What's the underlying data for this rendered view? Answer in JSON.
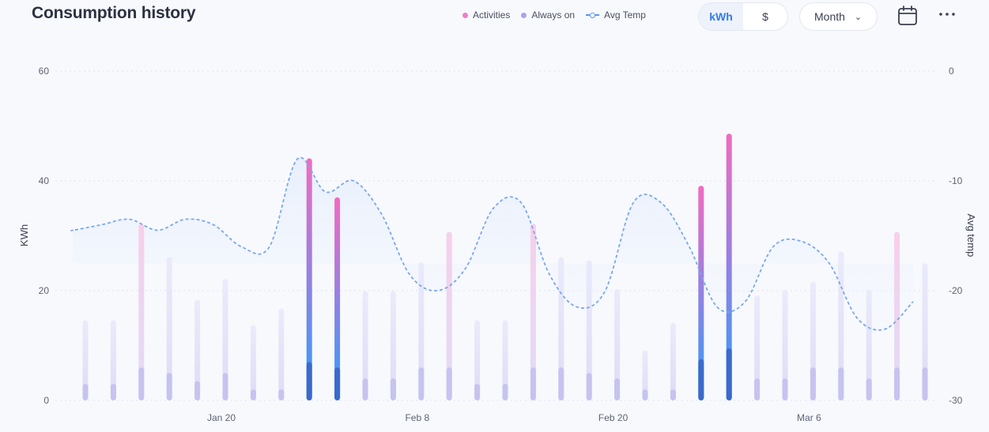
{
  "header": {
    "title": "Consumption history",
    "legend": [
      {
        "label": "Activities",
        "color": "#f07cc8"
      },
      {
        "label": "Always on",
        "color": "#a7a5e8"
      },
      {
        "label": "Avg Temp",
        "color": "#5a95ee"
      }
    ],
    "unit_toggle": {
      "options": [
        "kWh",
        "$"
      ],
      "selected": "kWh"
    },
    "period_select": {
      "value": "Month"
    },
    "icons": {
      "calendar": "calendar-icon",
      "more": "more-icon"
    }
  },
  "chart_data": {
    "type": "bar",
    "title": "Consumption history",
    "ylabel": "KWh",
    "ylabel_right": "Avg temp",
    "ylim": [
      0,
      60
    ],
    "ylim_right": [
      -30,
      0
    ],
    "yticks": [
      "0",
      "20",
      "40",
      "60"
    ],
    "yticks_right": [
      "-30",
      "-20",
      "-10",
      "0"
    ],
    "xtick_labels": [
      {
        "label": "Jan 20",
        "index": 5
      },
      {
        "label": "Feb 8",
        "index": 12
      },
      {
        "label": "Feb 20",
        "index": 19
      },
      {
        "label": "Mar 6",
        "index": 26
      }
    ],
    "highlighted_indices": [
      8,
      9,
      22,
      23
    ],
    "series": [
      {
        "name": "Always on",
        "values": [
          3,
          3,
          6,
          5,
          3.5,
          5,
          2,
          2,
          7,
          6,
          4,
          4,
          6,
          6,
          3,
          3,
          6,
          6,
          5,
          4,
          2,
          2,
          7.5,
          9.5,
          4,
          4,
          6,
          6,
          4,
          6,
          6
        ]
      },
      {
        "name": "Activities",
        "values": [
          14.6,
          14.6,
          32.2,
          26.1,
          18.3,
          22.1,
          13.7,
          16.7,
          44.1,
          37,
          19.9,
          19.9,
          25.1,
          30.7,
          14.6,
          14.6,
          32.2,
          26.1,
          25.5,
          20.3,
          9.1,
          14.1,
          39.1,
          48.6,
          19.1,
          20.1,
          21.6,
          27.1,
          20.1,
          30.7,
          25
        ]
      },
      {
        "name": "Avg Temp",
        "type": "line",
        "values": [
          -14.5,
          -14,
          -13.5,
          -14.5,
          -13.5,
          -14,
          -16,
          -16,
          -8,
          -11,
          -10,
          -13,
          -18.5,
          -20,
          -18,
          -12.5,
          -12,
          -18.5,
          -21.5,
          -20,
          -12,
          -12,
          -16,
          -21.5,
          -21,
          -16,
          -15.5,
          -17.5,
          -22.5,
          -23.5,
          -21
        ]
      }
    ]
  }
}
